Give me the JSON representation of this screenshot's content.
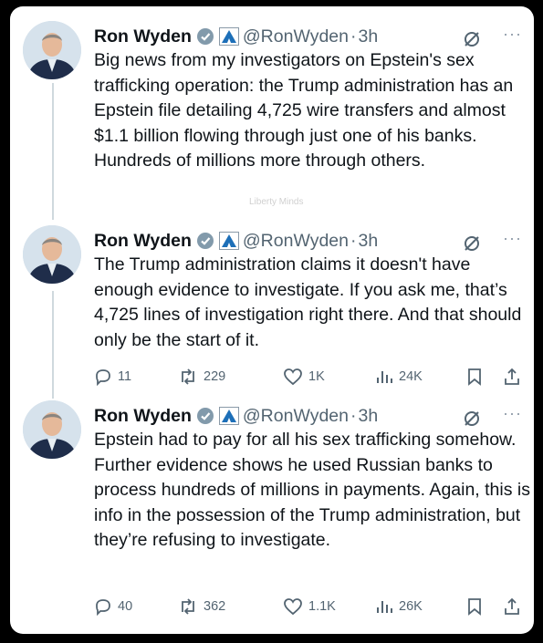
{
  "watermark": "Liberty Minds",
  "tweets": [
    {
      "name": "Ron Wyden",
      "handle": "@RonWyden",
      "separator": "·",
      "time": "3h",
      "text": "Big news from my investigators on Epstein's sex trafficking operation: the Trump administration has an Epstein file detailing 4,725 wire transfers and almost $1.1 billion flowing through just one of his banks. Hundreds of millions more through others.",
      "more": "···"
    },
    {
      "name": "Ron Wyden",
      "handle": "@RonWyden",
      "separator": "·",
      "time": "3h",
      "text": "The Trump administration claims it doesn't have enough evidence to investigate. If you ask me, that’s 4,725 lines of investigation right there. And that should only be the start of it.",
      "more": "···",
      "replies": "11",
      "reposts": "229",
      "likes": "1K",
      "views": "24K"
    },
    {
      "name": "Ron Wyden",
      "handle": "@RonWyden",
      "separator": "·",
      "time": "3h",
      "text": "Epstein had to pay for all his sex trafficking somehow. Further evidence shows he used Russian banks to process hundreds of millions in payments. Again, this is info in the possession of the Trump administration, but they’re refusing to investigate.",
      "more": "···",
      "replies": "40",
      "reposts": "362",
      "likes": "1.1K",
      "views": "26K"
    }
  ],
  "colors": {
    "background": "#000000",
    "card": "#ffffff",
    "text": "#0f1419",
    "secondary": "#536471",
    "thread_line": "#cfd9de",
    "verified_badge": "#829aab",
    "affiliate_badge": "#1d6fb8"
  },
  "icons": [
    "verified-badge-icon",
    "affiliation-badge-icon",
    "grok-icon",
    "more-icon",
    "reply-icon",
    "repost-icon",
    "like-icon",
    "views-icon",
    "bookmark-icon",
    "share-icon"
  ]
}
